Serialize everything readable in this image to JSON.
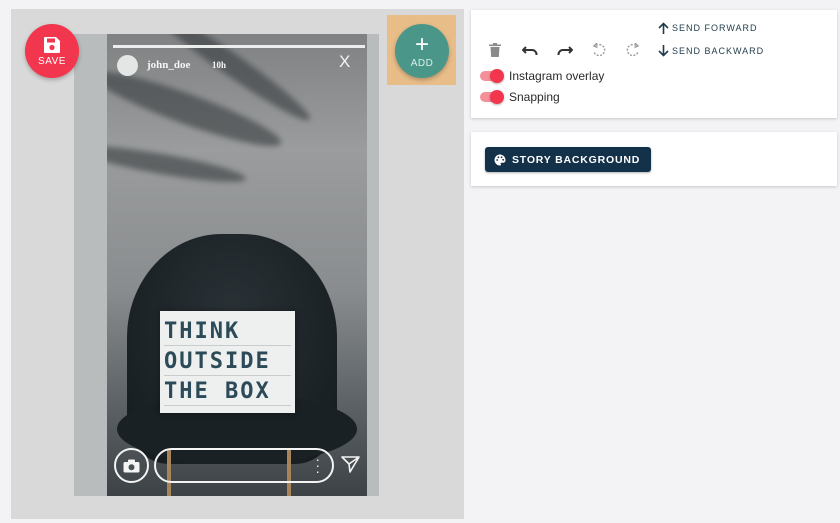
{
  "story_editor": {
    "save_button": {
      "label": "SAVE",
      "icon": "floppy-disk-icon",
      "color": "#f2364d"
    },
    "add_button": {
      "label": "ADD",
      "icon": "plus-icon",
      "color": "#4a978a"
    },
    "instagram_overlay": {
      "username": "john_doe",
      "time": "10h",
      "close_label": "X"
    },
    "story_image_text": [
      "THINK",
      "OUTSIDE",
      "THE  BOX"
    ]
  },
  "toolbar": {
    "icons": [
      "delete-icon",
      "undo-icon",
      "redo-icon",
      "rotate-left-icon",
      "rotate-right-icon"
    ],
    "send_forward_label": "SEND FORWARD",
    "send_backward_label": "SEND BACKWARD",
    "toggles": [
      {
        "label": "Instagram overlay",
        "on": true
      },
      {
        "label": "Snapping",
        "on": true
      }
    ]
  },
  "background_card": {
    "button_label": "STORY BACKGROUND",
    "icon": "palette-icon"
  }
}
